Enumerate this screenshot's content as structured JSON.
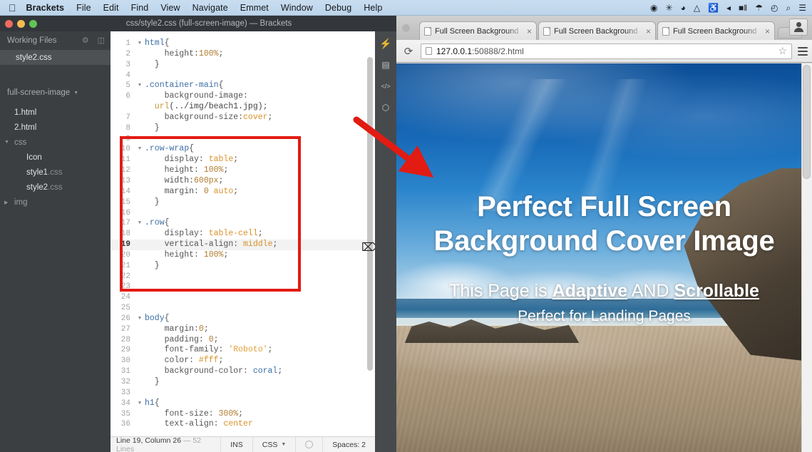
{
  "menubar": {
    "apple_icon": "apple-logo",
    "items": [
      {
        "label": "Brackets",
        "bold": true
      },
      {
        "label": "File",
        "bold": false
      },
      {
        "label": "Edit",
        "bold": false
      },
      {
        "label": "Find",
        "bold": false
      },
      {
        "label": "View",
        "bold": false
      },
      {
        "label": "Navigate",
        "bold": false
      },
      {
        "label": "Emmet",
        "bold": false
      },
      {
        "label": "Window",
        "bold": false
      },
      {
        "label": "Debug",
        "bold": false
      },
      {
        "label": "Help",
        "bold": false
      }
    ],
    "status_icons": [
      {
        "name": "screen-record-icon",
        "glyph": "◉"
      },
      {
        "name": "bluetooth-icon",
        "glyph": "✳"
      },
      {
        "name": "creative-cloud-icon",
        "glyph": "◑"
      },
      {
        "name": "google-drive-icon",
        "glyph": "△"
      },
      {
        "name": "notification-bell-icon",
        "glyph": "ὑ4"
      },
      {
        "name": "volume-icon",
        "glyph": "◂"
      },
      {
        "name": "battery-icon",
        "glyph": "ὐB"
      },
      {
        "name": "wifi-icon",
        "glyph": "◠"
      },
      {
        "name": "clock-icon",
        "glyph": "◴"
      },
      {
        "name": "spotlight-search-icon",
        "glyph": "⌕"
      },
      {
        "name": "notification-center-icon",
        "glyph": "☰"
      }
    ]
  },
  "brackets": {
    "window_title": "css/style2.css (full-screen-image) — Brackets",
    "traffic_lights": {
      "close": "#ed6b5f",
      "minimize": "#f4bd50",
      "zoom": "#61c455"
    },
    "sidebar": {
      "working_files_label": "Working Files",
      "gear_icon": "gear-icon",
      "split_icon": "split-view-icon",
      "open_file": "style2.css",
      "project_name": "full-screen-image",
      "tree": [
        {
          "label": "1.html",
          "ext": "",
          "level": 1,
          "type": "file",
          "twisty": ""
        },
        {
          "label": "2.html",
          "ext": "",
          "level": 1,
          "type": "file",
          "twisty": ""
        },
        {
          "label": "css",
          "ext": "",
          "level": 0,
          "type": "folder",
          "twisty": "▼"
        },
        {
          "label": "Icon",
          "ext": "",
          "level": 2,
          "type": "file",
          "twisty": ""
        },
        {
          "label": "style1",
          "ext": ".css",
          "level": 2,
          "type": "file",
          "twisty": ""
        },
        {
          "label": "style2",
          "ext": ".css",
          "level": 2,
          "type": "file",
          "twisty": ""
        },
        {
          "label": "img",
          "ext": "",
          "level": 0,
          "type": "folder",
          "twisty": "▶"
        }
      ]
    },
    "editor": {
      "active_line": 19,
      "lines": [
        {
          "n": "1",
          "fold": "▼",
          "tokens": [
            {
              "t": "html",
              "c": "k-sel"
            },
            {
              "t": "{",
              "c": "k-punc"
            }
          ]
        },
        {
          "n": "2",
          "fold": "",
          "tokens": [
            {
              "t": "    height:",
              "c": "k-prop"
            },
            {
              "t": "100%",
              "c": "k-num"
            },
            {
              "t": ";",
              "c": "k-punc"
            }
          ]
        },
        {
          "n": "3",
          "fold": "",
          "tokens": [
            {
              "t": "  }",
              "c": "k-punc"
            }
          ]
        },
        {
          "n": "4",
          "fold": "",
          "tokens": []
        },
        {
          "n": "5",
          "fold": "▼",
          "tokens": [
            {
              "t": ".container-main",
              "c": "k-sel"
            },
            {
              "t": "{",
              "c": "k-punc"
            }
          ]
        },
        {
          "n": "6",
          "fold": "",
          "tokens": [
            {
              "t": "    background-image:",
              "c": "k-prop"
            }
          ]
        },
        {
          "n": "",
          "fold": "",
          "tokens": [
            {
              "t": "  url",
              "c": "k-url"
            },
            {
              "t": "(../img/beach1.jpg)",
              "c": "k-plain"
            },
            {
              "t": ";",
              "c": "k-punc"
            }
          ]
        },
        {
          "n": "7",
          "fold": "",
          "tokens": [
            {
              "t": "    background-size:",
              "c": "k-prop"
            },
            {
              "t": "cover",
              "c": "k-val"
            },
            {
              "t": ";",
              "c": "k-punc"
            }
          ]
        },
        {
          "n": "8",
          "fold": "",
          "tokens": [
            {
              "t": "  }",
              "c": "k-punc"
            }
          ]
        },
        {
          "n": "9",
          "fold": "",
          "tokens": []
        },
        {
          "n": "10",
          "fold": "▼",
          "tokens": [
            {
              "t": ".row-wrap",
              "c": "k-sel"
            },
            {
              "t": "{",
              "c": "k-punc"
            }
          ]
        },
        {
          "n": "11",
          "fold": "",
          "tokens": [
            {
              "t": "    display: ",
              "c": "k-prop"
            },
            {
              "t": "table",
              "c": "k-val"
            },
            {
              "t": ";",
              "c": "k-punc"
            }
          ]
        },
        {
          "n": "12",
          "fold": "",
          "tokens": [
            {
              "t": "    height: ",
              "c": "k-prop"
            },
            {
              "t": "100%",
              "c": "k-num"
            },
            {
              "t": ";",
              "c": "k-punc"
            }
          ]
        },
        {
          "n": "13",
          "fold": "",
          "tokens": [
            {
              "t": "    width:",
              "c": "k-prop"
            },
            {
              "t": "600px",
              "c": "k-num"
            },
            {
              "t": ";",
              "c": "k-punc"
            }
          ]
        },
        {
          "n": "14",
          "fold": "",
          "tokens": [
            {
              "t": "    margin: ",
              "c": "k-prop"
            },
            {
              "t": "0",
              "c": "k-num"
            },
            {
              "t": " ",
              "c": "k-plain"
            },
            {
              "t": "auto",
              "c": "k-val"
            },
            {
              "t": ";",
              "c": "k-punc"
            }
          ]
        },
        {
          "n": "15",
          "fold": "",
          "tokens": [
            {
              "t": "  }",
              "c": "k-punc"
            }
          ]
        },
        {
          "n": "16",
          "fold": "",
          "tokens": []
        },
        {
          "n": "17",
          "fold": "▼",
          "tokens": [
            {
              "t": ".row",
              "c": "k-sel"
            },
            {
              "t": "{",
              "c": "k-punc"
            }
          ]
        },
        {
          "n": "18",
          "fold": "",
          "tokens": [
            {
              "t": "    display: ",
              "c": "k-prop"
            },
            {
              "t": "table-cell",
              "c": "k-val"
            },
            {
              "t": ";",
              "c": "k-punc"
            }
          ]
        },
        {
          "n": "19",
          "fold": "",
          "tokens": [
            {
              "t": "    vertical-align: ",
              "c": "k-prop"
            },
            {
              "t": "middle",
              "c": "k-val"
            },
            {
              "t": ";",
              "c": "k-punc"
            }
          ]
        },
        {
          "n": "20",
          "fold": "",
          "tokens": [
            {
              "t": "    height: ",
              "c": "k-prop"
            },
            {
              "t": "100%",
              "c": "k-num"
            },
            {
              "t": ";",
              "c": "k-punc"
            }
          ]
        },
        {
          "n": "21",
          "fold": "",
          "tokens": [
            {
              "t": "  }",
              "c": "k-punc"
            }
          ]
        },
        {
          "n": "22",
          "fold": "",
          "tokens": []
        },
        {
          "n": "23",
          "fold": "",
          "tokens": []
        },
        {
          "n": "24",
          "fold": "",
          "tokens": []
        },
        {
          "n": "25",
          "fold": "",
          "tokens": []
        },
        {
          "n": "26",
          "fold": "▼",
          "tokens": [
            {
              "t": "body",
              "c": "k-sel"
            },
            {
              "t": "{",
              "c": "k-punc"
            }
          ]
        },
        {
          "n": "27",
          "fold": "",
          "tokens": [
            {
              "t": "    margin:",
              "c": "k-prop"
            },
            {
              "t": "0",
              "c": "k-num"
            },
            {
              "t": ";",
              "c": "k-punc"
            }
          ]
        },
        {
          "n": "28",
          "fold": "",
          "tokens": [
            {
              "t": "    padding: ",
              "c": "k-prop"
            },
            {
              "t": "0",
              "c": "k-num"
            },
            {
              "t": ";",
              "c": "k-punc"
            }
          ]
        },
        {
          "n": "29",
          "fold": "",
          "tokens": [
            {
              "t": "    font-family: ",
              "c": "k-prop"
            },
            {
              "t": "'Roboto'",
              "c": "k-str"
            },
            {
              "t": ";",
              "c": "k-punc"
            }
          ]
        },
        {
          "n": "30",
          "fold": "",
          "tokens": [
            {
              "t": "    color: ",
              "c": "k-prop"
            },
            {
              "t": "#fff",
              "c": "k-val"
            },
            {
              "t": ";",
              "c": "k-punc"
            }
          ]
        },
        {
          "n": "31",
          "fold": "",
          "tokens": [
            {
              "t": "    background-color: ",
              "c": "k-prop"
            },
            {
              "t": "coral",
              "c": "k-sel"
            },
            {
              "t": ";",
              "c": "k-punc"
            }
          ]
        },
        {
          "n": "32",
          "fold": "",
          "tokens": [
            {
              "t": "  }",
              "c": "k-punc"
            }
          ]
        },
        {
          "n": "33",
          "fold": "",
          "tokens": []
        },
        {
          "n": "34",
          "fold": "▼",
          "tokens": [
            {
              "t": "h1",
              "c": "k-sel"
            },
            {
              "t": "{",
              "c": "k-punc"
            }
          ]
        },
        {
          "n": "35",
          "fold": "",
          "tokens": [
            {
              "t": "    font-size: ",
              "c": "k-prop"
            },
            {
              "t": "300%",
              "c": "k-num"
            },
            {
              "t": ";",
              "c": "k-punc"
            }
          ]
        },
        {
          "n": "36",
          "fold": "",
          "tokens": [
            {
              "t": "    text-align: ",
              "c": "k-prop"
            },
            {
              "t": "center",
              "c": "k-val"
            }
          ]
        }
      ]
    },
    "toolbar_icons": [
      {
        "name": "live-preview-icon",
        "glyph": "⚡"
      },
      {
        "name": "extension-manager-icon",
        "glyph": "▤"
      },
      {
        "name": "code-inspection-icon",
        "glyph": "</>"
      },
      {
        "name": "emmet-icon",
        "glyph": "⬡"
      }
    ],
    "status_bar": {
      "cursor": "Line 19, Column 26",
      "separator": "—",
      "line_count": "52 Lines",
      "insert_mode": "INS",
      "language": "CSS",
      "language_caret": "▼",
      "lint_icon": "lint-status-icon",
      "indent": "Spaces: 2"
    }
  },
  "browser": {
    "tabs": [
      {
        "title": "Full Screen Background",
        "active": false,
        "close": "×"
      },
      {
        "title": "Full Screen Background",
        "active": true,
        "close": "×"
      },
      {
        "title": "Full Screen Background",
        "active": false,
        "close": "×"
      }
    ],
    "new_tab_icon": "new-tab-button",
    "avatar_icon": "user-avatar-icon",
    "reload_icon": "⟳",
    "url_host": "127.0.0.1",
    "url_rest": ":50888/2.html",
    "url_full": "127.0.0.1:50888/2.html",
    "bookmark_icon": "☆",
    "menu_icon": "chrome-menu-icon",
    "page": {
      "headline_line1": "Perfect Full Screen",
      "headline_line2": "Background Cover Image",
      "sub_prefix": "This Page is ",
      "sub_bold1": "Adaptive",
      "sub_middle": " AND ",
      "sub_bold2": "Scrollable",
      "tagline": "Perfect for Landing Pages"
    }
  },
  "annotation": {
    "arrow_color": "#e21b13",
    "highlight_box_color": "#e21b13",
    "highlight_target": "lines 10-21 (.row-wrap and .row rules)"
  }
}
